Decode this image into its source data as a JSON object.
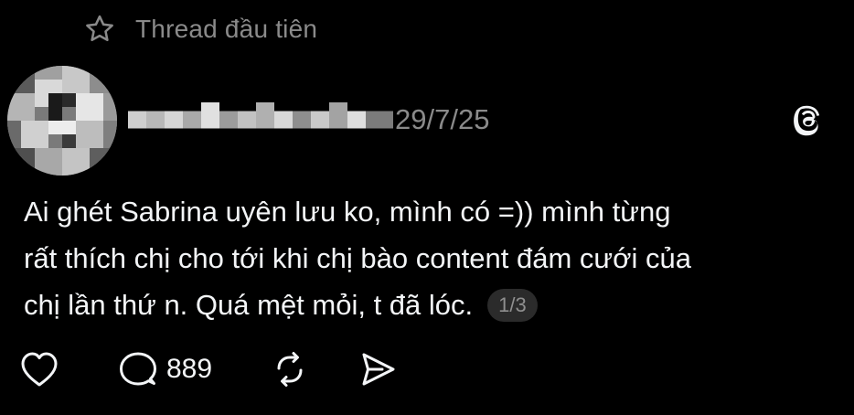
{
  "pinned": {
    "label": "Thread đầu tiên",
    "icon": "star-icon"
  },
  "post": {
    "username": "",
    "date": "29/7/25",
    "lines": [
      "Ai ghét Sabrina uyên lưu ko, mình có =)) mình từng",
      "rất thích chị cho tới khi chị bào content đám cưới của",
      "chị lần thứ n. Quá mệt mỏi, t đã lóc."
    ],
    "page_indicator": "1/3"
  },
  "actions": {
    "like_icon": "heart-icon",
    "reply_icon": "comment-icon",
    "reply_count": "889",
    "repost_icon": "repost-icon",
    "share_icon": "send-icon"
  },
  "brand": {
    "icon": "threads-logo-icon"
  },
  "colors": {
    "background": "#000000",
    "text": "#f3f5f7",
    "muted": "#8a8a8a",
    "pill": "#2b2b2b"
  }
}
